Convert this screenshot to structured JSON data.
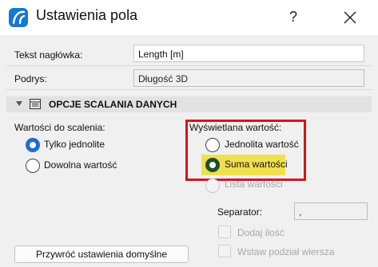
{
  "window": {
    "title": "Ustawienia pola",
    "help_label": "?",
    "close_icon": "close-icon",
    "app_icon": "archicad-logo-icon"
  },
  "fields": {
    "header_text_label": "Tekst nagłówka:",
    "header_text_value": "Length [m]",
    "caption_label": "Podrys:",
    "caption_value": "Długość 3D"
  },
  "section": {
    "title": "OPCJE SCALANIA DANYCH",
    "icon": "table-icon",
    "expanded": true
  },
  "merge_values": {
    "label": "Wartości do scalenia:",
    "options": [
      {
        "label": "Tylko jednolite",
        "selected": true
      },
      {
        "label": "Dowolna wartość",
        "selected": false
      }
    ]
  },
  "displayed_value": {
    "label": "Wyświetlana wartość:",
    "options": [
      {
        "label": "Jednolita wartość",
        "selected": false,
        "enabled": true
      },
      {
        "label": "Suma wartości",
        "selected": true,
        "enabled": true
      },
      {
        "label": "Lista wartości",
        "selected": false,
        "enabled": false
      }
    ]
  },
  "separator": {
    "label": "Separator:",
    "value": ","
  },
  "checkboxes": [
    {
      "label": "Dodaj ilość",
      "checked": false,
      "enabled": false
    },
    {
      "label": "Wstaw podział wiersza",
      "checked": false,
      "enabled": false
    }
  ],
  "reset_button": "Przywróć ustawienia domyślne",
  "colors": {
    "annotation_box": "#d8131a",
    "highlight": "#f0e050",
    "accent_radio": "#1e6ad8"
  }
}
